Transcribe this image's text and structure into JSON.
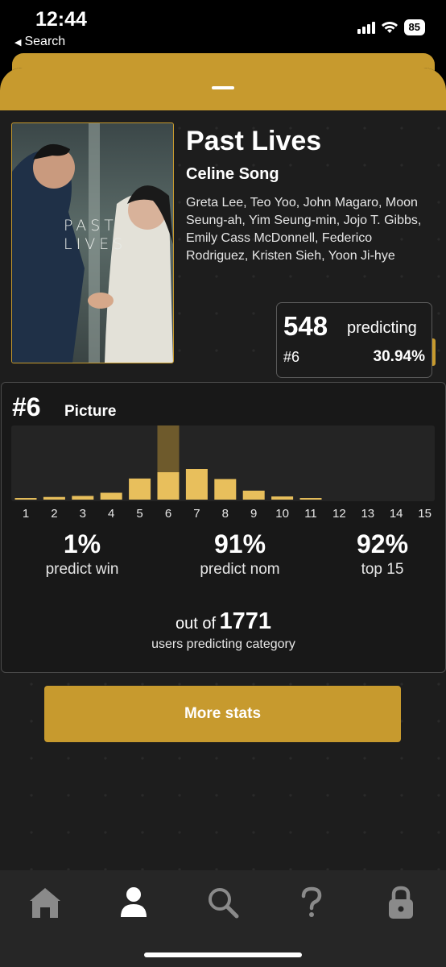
{
  "status_bar": {
    "time": "12:44",
    "back_label": "Search",
    "battery": "85"
  },
  "movie": {
    "title": "Past Lives",
    "director": "Celine Song",
    "cast": "Greta Lee, Teo Yoo, John Magaro, Moon Seung-ah, Yim Seung-min, Jojo T. Gibbs, Emily Cass McDonnell, Federico Rodriguez, Kristen Sieh, Yoon Ji-hye",
    "poster_text": "PAST LIVES"
  },
  "prediction": {
    "count": "548",
    "label": "predicting",
    "rank": "#6",
    "percent": "30.94%"
  },
  "category": {
    "rank": "#6",
    "name": "Picture",
    "stats": {
      "win": {
        "value": "1%",
        "label": "predict win"
      },
      "nom": {
        "value": "91%",
        "label": "predict nom"
      },
      "top": {
        "value": "92%",
        "label": "top 15"
      }
    },
    "out_of_prefix": "out of",
    "total_users": "1771",
    "users_label": "users predicting category"
  },
  "chart_data": {
    "type": "bar",
    "categories": [
      "1",
      "2",
      "3",
      "4",
      "5",
      "6",
      "7",
      "8",
      "9",
      "10",
      "11",
      "12",
      "13",
      "14",
      "15"
    ],
    "values": [
      0.3,
      0.5,
      0.7,
      1.3,
      4.0,
      30.9,
      5.8,
      3.9,
      1.7,
      0.6,
      0.3,
      0,
      0,
      0,
      0
    ],
    "highlight": "6",
    "color": "#e8bf5c",
    "highlight_bg": "#6e5a2c"
  },
  "more_button": "More stats",
  "tabbar": [
    "home-icon",
    "person-icon",
    "search-icon",
    "question-icon",
    "lock-icon"
  ],
  "colors": {
    "accent": "#c79a2e",
    "bar": "#e8bf5c",
    "background": "#1d1d1d",
    "tab_inactive": "#8a8a8a"
  }
}
